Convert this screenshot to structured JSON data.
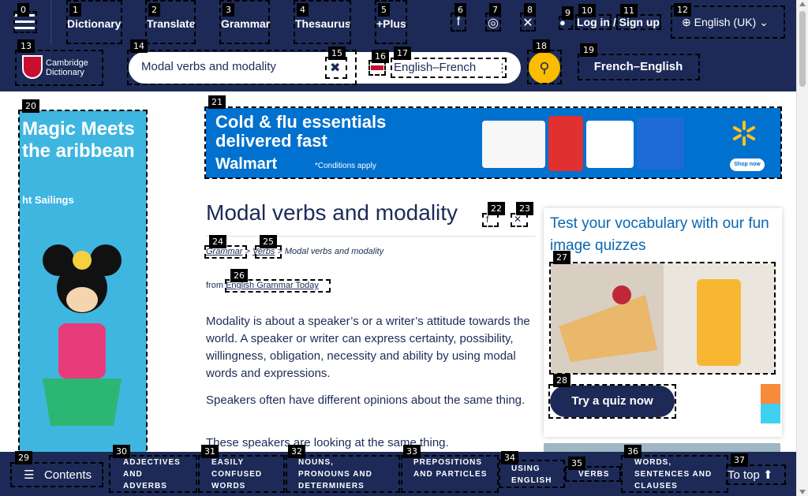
{
  "header": {
    "nav": [
      "Dictionary",
      "Translate",
      "Grammar",
      "Thesaurus",
      "+Plus"
    ],
    "login": "Log in / Sign up",
    "language": "English (UK)",
    "logo_line1": "Cambridge",
    "logo_line2": "Dictionary"
  },
  "search": {
    "value": "Modal verbs and modality",
    "dict": "English–French",
    "reverse": "French–English"
  },
  "ads": {
    "left_title": "Magic Meets the aribbean",
    "left_sub": "ht Sailings",
    "top_line1": "Cold & flu essentials",
    "top_line2": "delivered fast",
    "top_brand": "Walmart",
    "top_cond": "*Conditions apply",
    "top_shop": "Shop now"
  },
  "article": {
    "title": "Modal verbs and modality",
    "crumb_grammar": "Grammar",
    "crumb_verbs": "Verbs",
    "crumb_current": "Modal verbs and modality",
    "from_label": "from",
    "from_link": "English Grammar Today",
    "p1": "Modality  is about a speaker’s or a writer’s attitude towards the world. A speaker or writer can express certainty, possibility, willingness, obligation, necessity and ability by using modal words and expressions.",
    "p2": "Speakers often have different opinions about the same thing.",
    "p3": "These speakers are looking at the same thing."
  },
  "quiz": {
    "text": "Test your vocabulary with our fun image quizzes",
    "button": "Try a quiz now"
  },
  "bottom": {
    "contents": "Contents",
    "links": [
      "ADJECTIVES AND ADVERBS",
      "EASILY CONFUSED WORDS",
      "NOUNS, PRONOUNS AND DETERMINERS",
      "PREPOSITIONS AND PARTICLES",
      "USING ENGLISH",
      "VERBS",
      "WORDS, SENTENCES AND CLAUSES"
    ],
    "to_top": "To top"
  },
  "colors": {
    "brand": "#1d2a57",
    "accent": "#fcbc00"
  }
}
